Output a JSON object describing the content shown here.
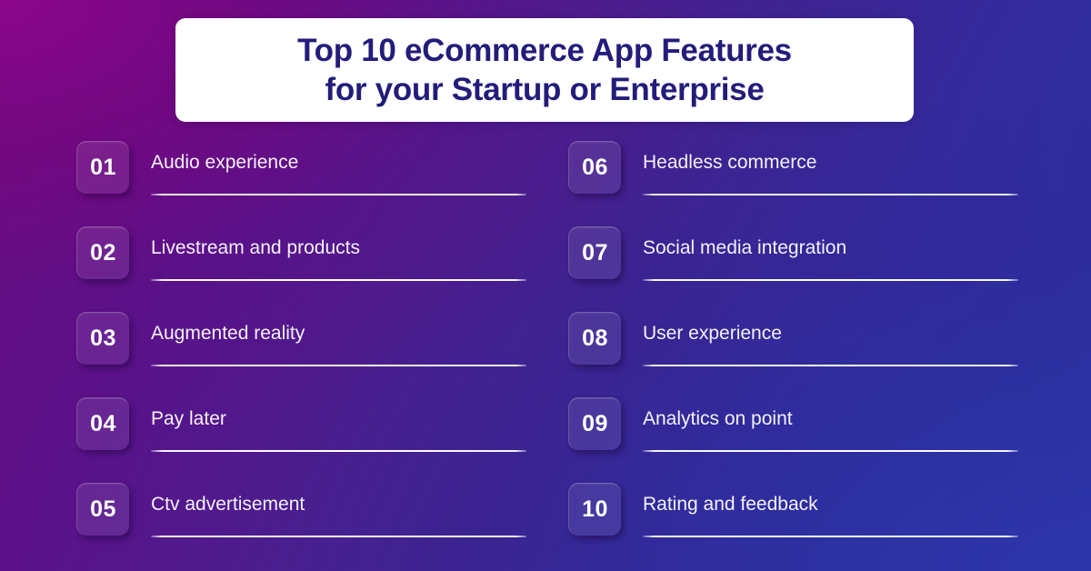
{
  "title": {
    "line1": "Top 10 eCommerce App Features",
    "line2": "for your Startup or Enterprise"
  },
  "colors": {
    "background_start": "#730B7E",
    "background_mid": "#3E2391",
    "background_end": "#2E36A8",
    "title_text": "#231C7A",
    "card_background": "#FFFFFF",
    "item_text": "#F4F1FB",
    "rule": "#FFFFFF"
  },
  "columns": [
    {
      "items": [
        {
          "number": "01",
          "label": "Audio experience"
        },
        {
          "number": "02",
          "label": "Livestream and products"
        },
        {
          "number": "03",
          "label": "Augmented reality"
        },
        {
          "number": "04",
          "label": "Pay later"
        },
        {
          "number": "05",
          "label": "Ctv advertisement"
        }
      ]
    },
    {
      "items": [
        {
          "number": "06",
          "label": "Headless commerce"
        },
        {
          "number": "07",
          "label": "Social media integration"
        },
        {
          "number": "08",
          "label": "User experience"
        },
        {
          "number": "09",
          "label": "Analytics on point"
        },
        {
          "number": "10",
          "label": "Rating and feedback"
        }
      ]
    }
  ]
}
